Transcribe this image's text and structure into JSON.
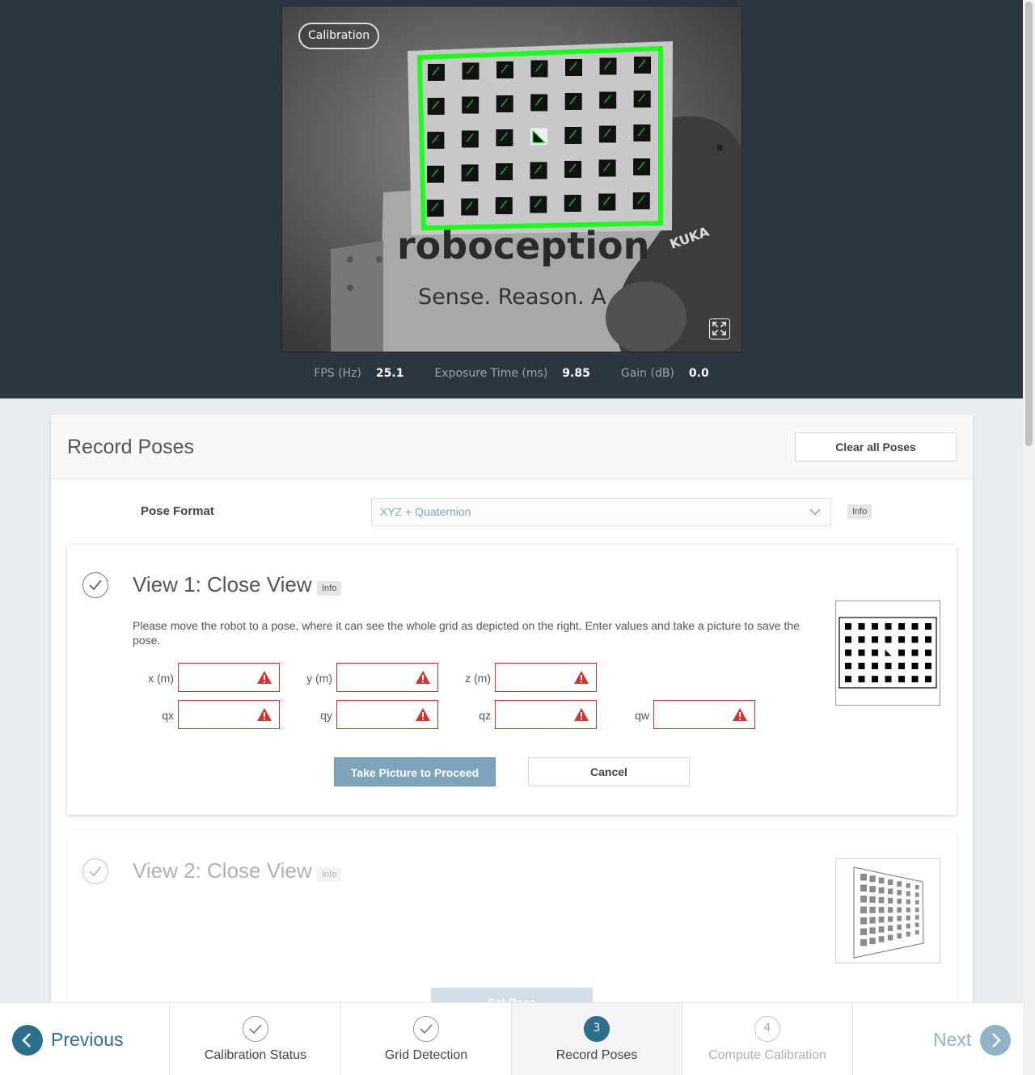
{
  "camera": {
    "badge": "Calibration",
    "image_text_brand": "roboception",
    "image_text_slogan": "Sense. Reason. A",
    "image_text_robot": "KUKA"
  },
  "stats": {
    "fps_label": "FPS (Hz)",
    "fps_value": "25.1",
    "exposure_label": "Exposure Time (ms)",
    "exposure_value": "9.85",
    "gain_label": "Gain (dB)",
    "gain_value": "0.0"
  },
  "panel": {
    "title": "Record Poses",
    "clear_button": "Clear all Poses",
    "pose_format_label": "Pose Format",
    "pose_format_value": "XYZ + Quaternion",
    "info_label": "Info"
  },
  "view1": {
    "title": "View 1: Close View",
    "info": "Info",
    "description": "Please move the robot to a pose, where it can see the whole grid as depicted on the right. Enter values and take a picture to save the pose.",
    "fields": {
      "x": "x (m)",
      "y": "y (m)",
      "z": "z (m)",
      "qx": "qx",
      "qy": "qy",
      "qz": "qz",
      "qw": "qw"
    },
    "take_picture": "Take Picture to Proceed",
    "cancel": "Cancel"
  },
  "view2": {
    "title": "View 2: Close View",
    "info": "Info",
    "set_pose": "Set Pose"
  },
  "nav": {
    "previous": "Previous",
    "next": "Next",
    "steps": [
      {
        "label": "Calibration Status",
        "state": "done"
      },
      {
        "label": "Grid Detection",
        "state": "done"
      },
      {
        "label": "Record Poses",
        "number": "3",
        "state": "active"
      },
      {
        "label": "Compute Calibration",
        "number": "4",
        "state": "disabled"
      }
    ]
  },
  "colors": {
    "accent": "#2c6f8c",
    "error": "#d9322a",
    "header_bg": "#2c3640",
    "grid_detect": "#19ff19"
  }
}
